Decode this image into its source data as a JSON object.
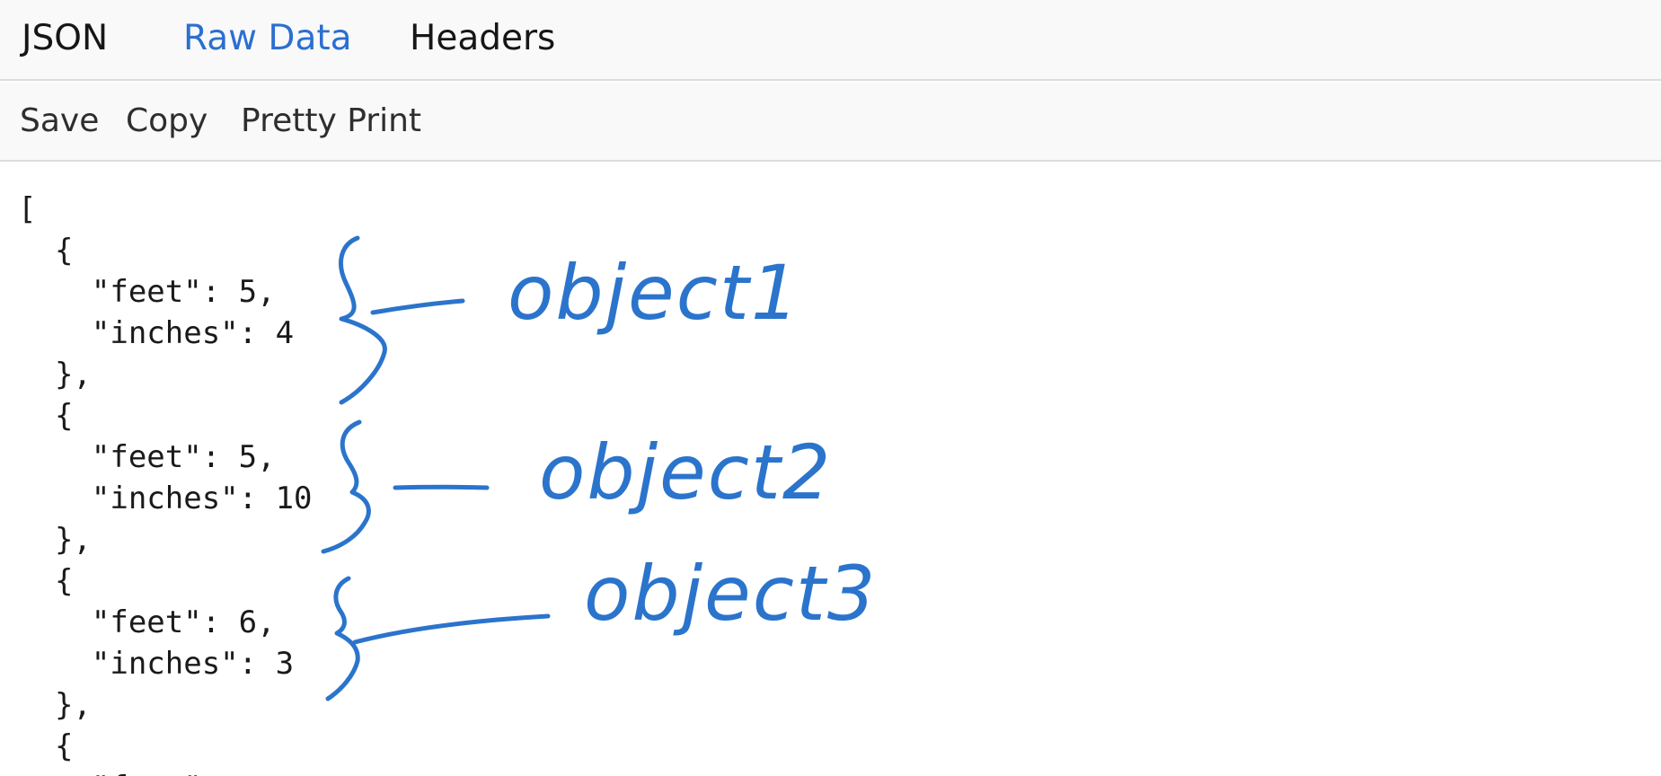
{
  "tabs": [
    {
      "label": "JSON",
      "active": false
    },
    {
      "label": "Raw Data",
      "active": true
    },
    {
      "label": "Headers",
      "active": false
    }
  ],
  "toolbar": {
    "save_label": "Save",
    "copy_label": "Copy",
    "pretty_print_label": "Pretty Print"
  },
  "code_lines": [
    "[",
    "  {",
    "    \"feet\": 5,",
    "    \"inches\": 4",
    "  },",
    "  {",
    "    \"feet\": 5,",
    "    \"inches\": 10",
    "  },",
    "  {",
    "    \"feet\": 6,",
    "    \"inches\": 3",
    "  },",
    "  {",
    "    \"feet\""
  ],
  "annotations": {
    "labels": [
      "object1",
      "object2",
      "object3"
    ],
    "ink_color": "#2b74cc"
  },
  "colors": {
    "active_tab": "#2b6fd0",
    "bar_background": "#f9f9fa"
  }
}
